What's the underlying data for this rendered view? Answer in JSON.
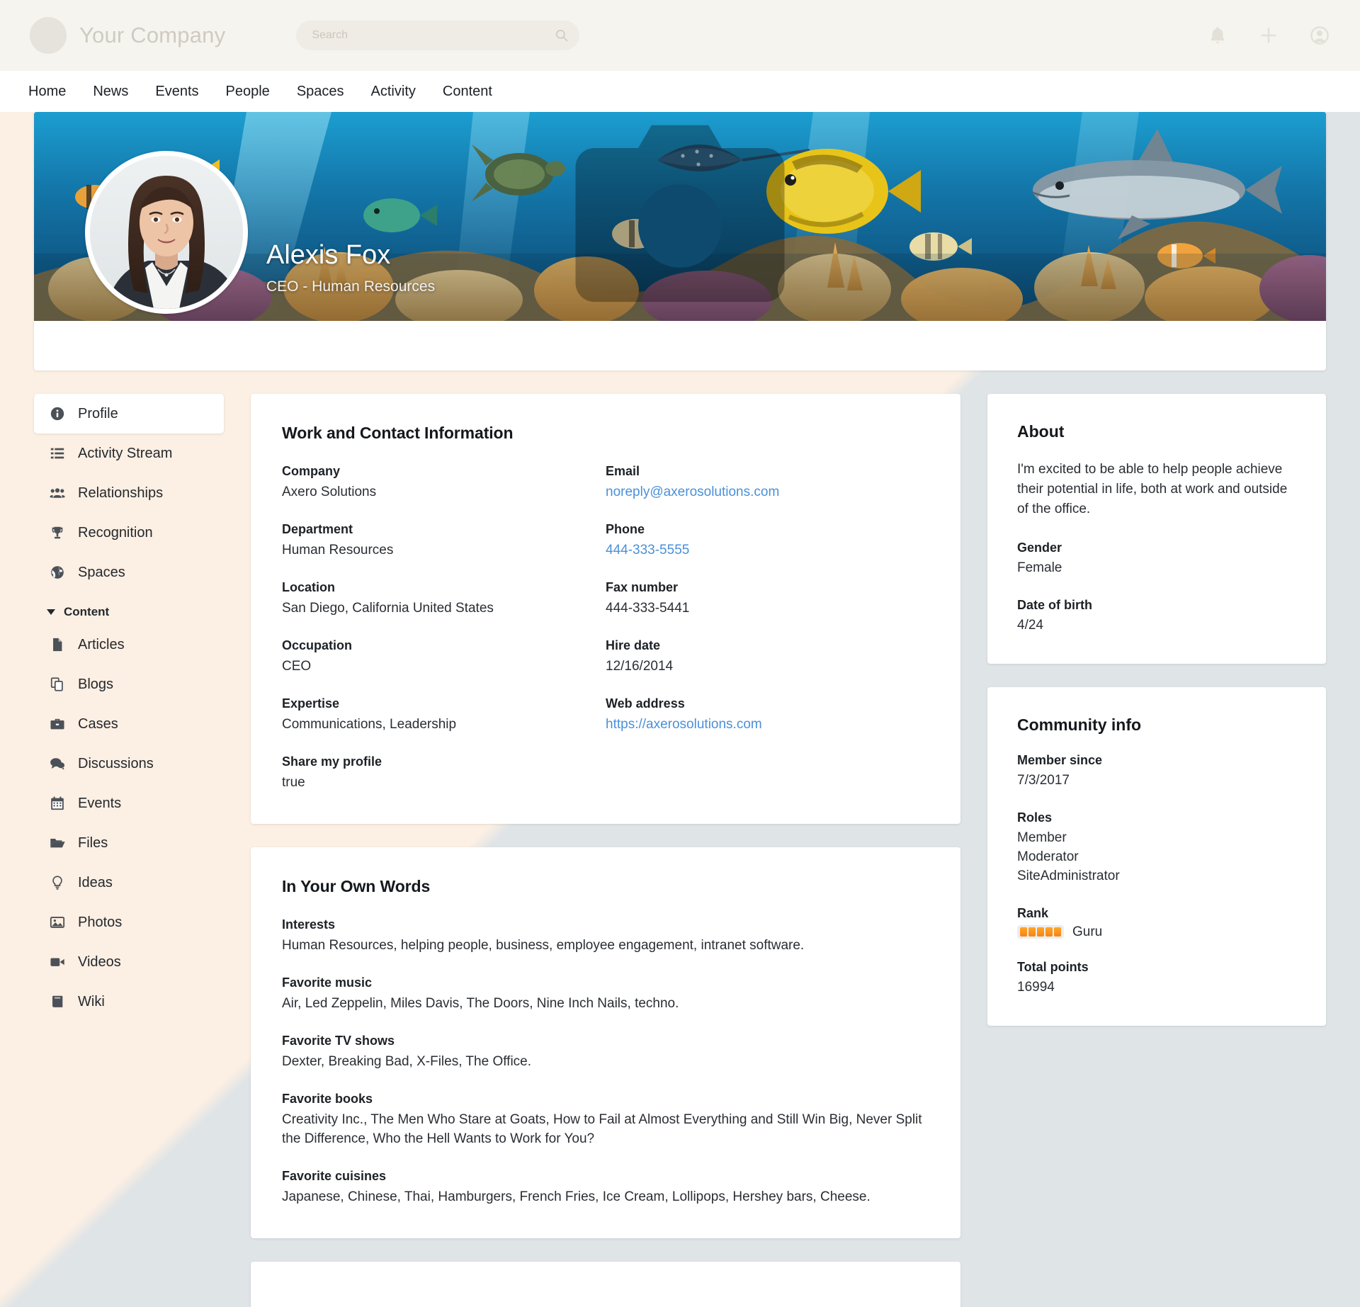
{
  "brand": {
    "name": "Your Company",
    "logo_icon": "circle-logo-placeholder"
  },
  "search": {
    "placeholder": "Search",
    "value": "",
    "icon": "search-icon"
  },
  "topbar_actions": [
    {
      "name": "notifications",
      "icon": "bell-icon"
    },
    {
      "name": "create",
      "icon": "plus-icon"
    },
    {
      "name": "account",
      "icon": "user-circle-icon"
    }
  ],
  "nav": {
    "items": [
      {
        "label": "Home"
      },
      {
        "label": "News"
      },
      {
        "label": "Events"
      },
      {
        "label": "People"
      },
      {
        "label": "Spaces"
      },
      {
        "label": "Activity"
      },
      {
        "label": "Content"
      }
    ]
  },
  "hero": {
    "name": "Alexis Fox",
    "title": "CEO - Human Resources",
    "banner_camera_icon": "camera-icon",
    "avatar_camera_icon": "camera-icon",
    "banner_alt": "underwater coral reef with tropical fish, sea turtle, stingray and shark",
    "avatar_alt": "portrait photo of woman with long dark hair in dark blazer and white shirt"
  },
  "sidebar": {
    "items": [
      {
        "label": "Profile",
        "icon": "info-circle-icon",
        "active": true
      },
      {
        "label": "Activity Stream",
        "icon": "list-icon",
        "active": false
      },
      {
        "label": "Relationships",
        "icon": "users-icon",
        "active": false
      },
      {
        "label": "Recognition",
        "icon": "trophy-icon",
        "active": false
      },
      {
        "label": "Spaces",
        "icon": "globe-icon",
        "active": false
      }
    ],
    "group": {
      "label": "Content",
      "icon": "caret-down-icon",
      "expanded": true
    },
    "sub_items": [
      {
        "label": "Articles",
        "icon": "document-icon"
      },
      {
        "label": "Blogs",
        "icon": "blogs-icon"
      },
      {
        "label": "Cases",
        "icon": "briefcase-icon"
      },
      {
        "label": "Discussions",
        "icon": "chat-icon"
      },
      {
        "label": "Events",
        "icon": "calendar-icon"
      },
      {
        "label": "Files",
        "icon": "folder-icon"
      },
      {
        "label": "Ideas",
        "icon": "lightbulb-icon"
      },
      {
        "label": "Photos",
        "icon": "image-icon"
      },
      {
        "label": "Videos",
        "icon": "video-icon"
      },
      {
        "label": "Wiki",
        "icon": "book-icon"
      }
    ]
  },
  "work_card": {
    "title": "Work and Contact Information",
    "left_fields": [
      {
        "label": "Company",
        "value": "Axero Solutions",
        "link": false
      },
      {
        "label": "Department",
        "value": "Human Resources",
        "link": false
      },
      {
        "label": "Location",
        "value": "San Diego, California United States",
        "link": false
      },
      {
        "label": "Occupation",
        "value": "CEO",
        "link": false
      },
      {
        "label": "Expertise",
        "value": "Communications, Leadership",
        "link": false
      },
      {
        "label": "Share my profile",
        "value": "true",
        "link": false
      }
    ],
    "right_fields": [
      {
        "label": "Email",
        "value": "noreply@axerosolutions.com",
        "link": true
      },
      {
        "label": "Phone",
        "value": "444-333-5555",
        "link": true
      },
      {
        "label": "Fax number",
        "value": "444-333-5441",
        "link": false
      },
      {
        "label": "Hire date",
        "value": "12/16/2014",
        "link": false
      },
      {
        "label": "Web address",
        "value": "https://axerosolutions.com",
        "link": true
      }
    ]
  },
  "own_words_card": {
    "title": "In Your Own Words",
    "fields": [
      {
        "label": "Interests",
        "value": "Human Resources, helping people, business, employee engagement, intranet software."
      },
      {
        "label": "Favorite music",
        "value": "Air, Led Zeppelin, Miles Davis, The Doors, Nine Inch Nails, techno."
      },
      {
        "label": "Favorite TV shows",
        "value": "Dexter, Breaking Bad, X-Files, The Office."
      },
      {
        "label": "Favorite books",
        "value": "Creativity Inc., The Men Who Stare at Goats, How to Fail at Almost Everything and Still Win Big, Never Split the Difference, Who the Hell Wants to Work for You?"
      },
      {
        "label": "Favorite cuisines",
        "value": "Japanese, Chinese, Thai, Hamburgers, French Fries, Ice Cream, Lollipops, Hershey bars, Cheese."
      }
    ]
  },
  "about_card": {
    "title": "About",
    "bio": "I'm excited to be able to help people achieve their potential in life, both at work and outside of the office.",
    "fields": [
      {
        "label": "Gender",
        "value": "Female"
      },
      {
        "label": "Date of birth",
        "value": "4/24"
      }
    ]
  },
  "community_card": {
    "title": "Community info",
    "member_since_label": "Member since",
    "member_since_value": "7/3/2017",
    "roles_label": "Roles",
    "roles": [
      "Member",
      "Moderator",
      "SiteAdministrator"
    ],
    "rank_label": "Rank",
    "rank_name": "Guru",
    "rank_pips": 5,
    "total_points_label": "Total points",
    "total_points_value": "16994"
  },
  "colors": {
    "bg_cream": "#FCEFE3",
    "bg_grey": "#DFE4E7",
    "topbar": "#F6F4EF",
    "link": "#4A90D9",
    "rank_orange": "#F58414",
    "text": "#2A2E33"
  }
}
